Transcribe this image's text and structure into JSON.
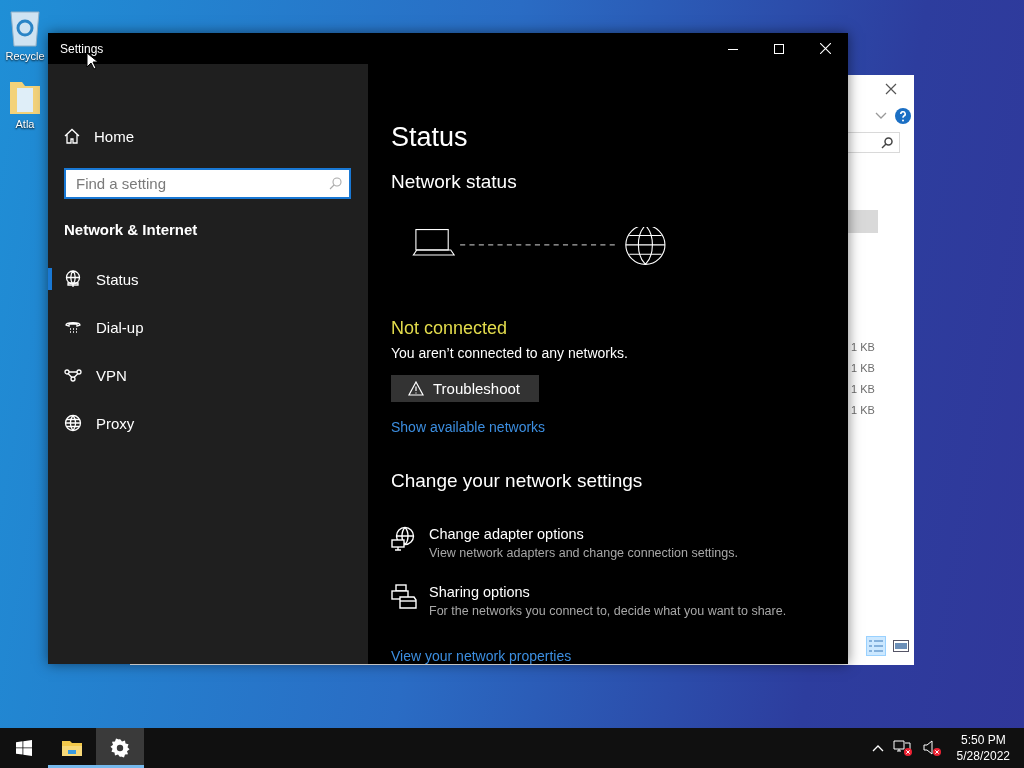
{
  "desktop": {
    "icons": [
      {
        "label": "Recycle"
      },
      {
        "label": "Atla"
      }
    ]
  },
  "background_window": {
    "sizes": [
      "1 KB",
      "1 KB",
      "1 KB",
      "1 KB"
    ]
  },
  "window": {
    "title": "Settings"
  },
  "sidebar": {
    "home": "Home",
    "search": {
      "placeholder": "Find a setting"
    },
    "section": "Network & Internet",
    "items": [
      {
        "label": "Status",
        "selected": true
      },
      {
        "label": "Dial-up",
        "selected": false
      },
      {
        "label": "VPN",
        "selected": false
      },
      {
        "label": "Proxy",
        "selected": false
      }
    ]
  },
  "main": {
    "title": "Status",
    "network_status": {
      "heading": "Network status",
      "state": "Not connected",
      "message": "You aren’t connected to any networks.",
      "troubleshoot": "Troubleshoot",
      "link": "Show available networks"
    },
    "change": {
      "heading": "Change your network settings",
      "options": [
        {
          "title": "Change adapter options",
          "description": "View network adapters and change connection settings."
        },
        {
          "title": "Sharing options",
          "description": "For the networks you connect to, decide what you want to share."
        }
      ],
      "link": "View your network properties"
    }
  },
  "taskbar": {
    "apps": [
      {
        "selected": false
      },
      {
        "selected": true
      }
    ],
    "clock": {
      "time": "5:50 PM",
      "date": "5/28/2022"
    }
  }
}
